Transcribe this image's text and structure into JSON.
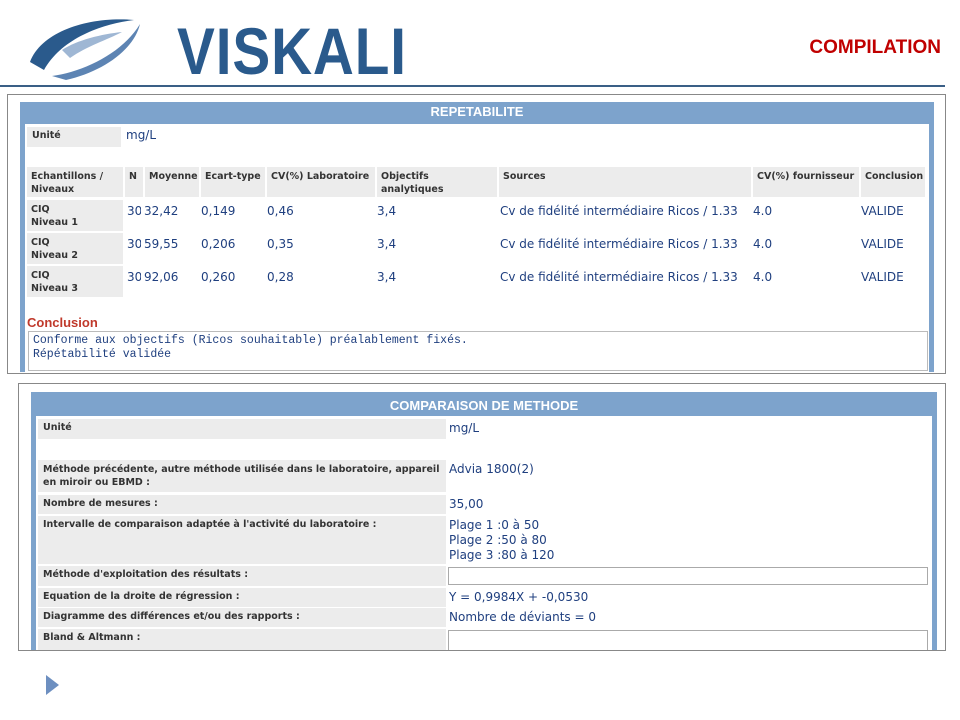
{
  "header": {
    "logo_text": "VISKALI",
    "title": "COMPILATION"
  },
  "repetabilite": {
    "title": "REPETABILITE",
    "unit_label": "Unité",
    "unit_value": "mg/L",
    "columns": [
      "Echantillons / Niveaux",
      "N",
      "Moyenne",
      "Ecart-type",
      "CV(%) Laboratoire",
      "Objectifs analytiques",
      "Sources",
      "CV(%) fournisseur",
      "Conclusion"
    ],
    "rows": [
      {
        "sample": "CIQ",
        "level": "Niveau 1",
        "n": "30",
        "mean": "32,42",
        "sd": "0,149",
        "cv_lab": "0,46",
        "objective": "3,4",
        "source": "Cv de fidélité intermédiaire Ricos / 1.33",
        "cv_supplier": "4.0",
        "conclusion": "VALIDE"
      },
      {
        "sample": "CIQ",
        "level": "Niveau 2",
        "n": "30",
        "mean": "59,55",
        "sd": "0,206",
        "cv_lab": "0,35",
        "objective": "3,4",
        "source": "Cv de fidélité intermédiaire Ricos / 1.33",
        "cv_supplier": "4.0",
        "conclusion": "VALIDE"
      },
      {
        "sample": "CIQ",
        "level": "Niveau 3",
        "n": "30",
        "mean": "92,06",
        "sd": "0,260",
        "cv_lab": "0,28",
        "objective": "3,4",
        "source": "Cv de fidélité intermédiaire Ricos / 1.33",
        "cv_supplier": "4.0",
        "conclusion": "VALIDE"
      }
    ],
    "conclusion_label": "Conclusion",
    "conclusion_line1": "Conforme aux objectifs (Ricos souhaitable) préalablement fixés.",
    "conclusion_line2": "Répétabilité validée"
  },
  "comparaison": {
    "title": "COMPARAISON DE METHODE",
    "unit_label": "Unité",
    "unit_value": "mg/L",
    "method_label": "Méthode précédente, autre méthode utilisée dans le laboratoire, appareil en miroir ou EBMD :",
    "method_value": "Advia 1800(2)",
    "measures_label": "Nombre de mesures :",
    "measures_value": "35,00",
    "interval_label": "Intervalle de comparaison adaptée à l'activité du laboratoire :",
    "interval_1": "Plage 1 :0 à 50",
    "interval_2": "Plage 2 :50 à 80",
    "interval_3": "Plage 3 :80 à 120",
    "exploitation_label": "Méthode d'exploitation des résultats :",
    "equation_label": "Equation de la droite de régression :",
    "equation_value": "Y = 0,9984X + -0,0530",
    "diagram_label": "Diagramme des différences et/ou des rapports :",
    "diagram_value": "Nombre de déviants = 0",
    "bland_label": "Bland & Altmann :"
  }
}
